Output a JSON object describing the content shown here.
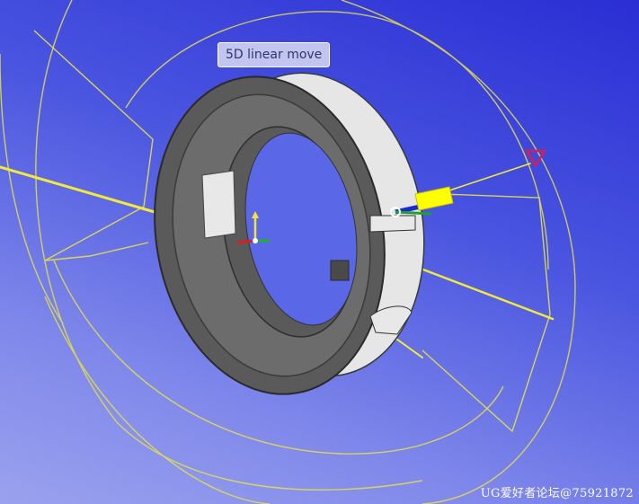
{
  "viewport": {
    "tooltip": "5D linear move",
    "watermark": "UG爱好者论坛@75921872"
  },
  "colors": {
    "background_top": "#2a2ed4",
    "background_bottom": "#9aa2ee",
    "toolpath": "#e6e04a",
    "part_body": "#555555",
    "part_face": "#e8e8e8",
    "tool_marker": "#d0205a"
  }
}
